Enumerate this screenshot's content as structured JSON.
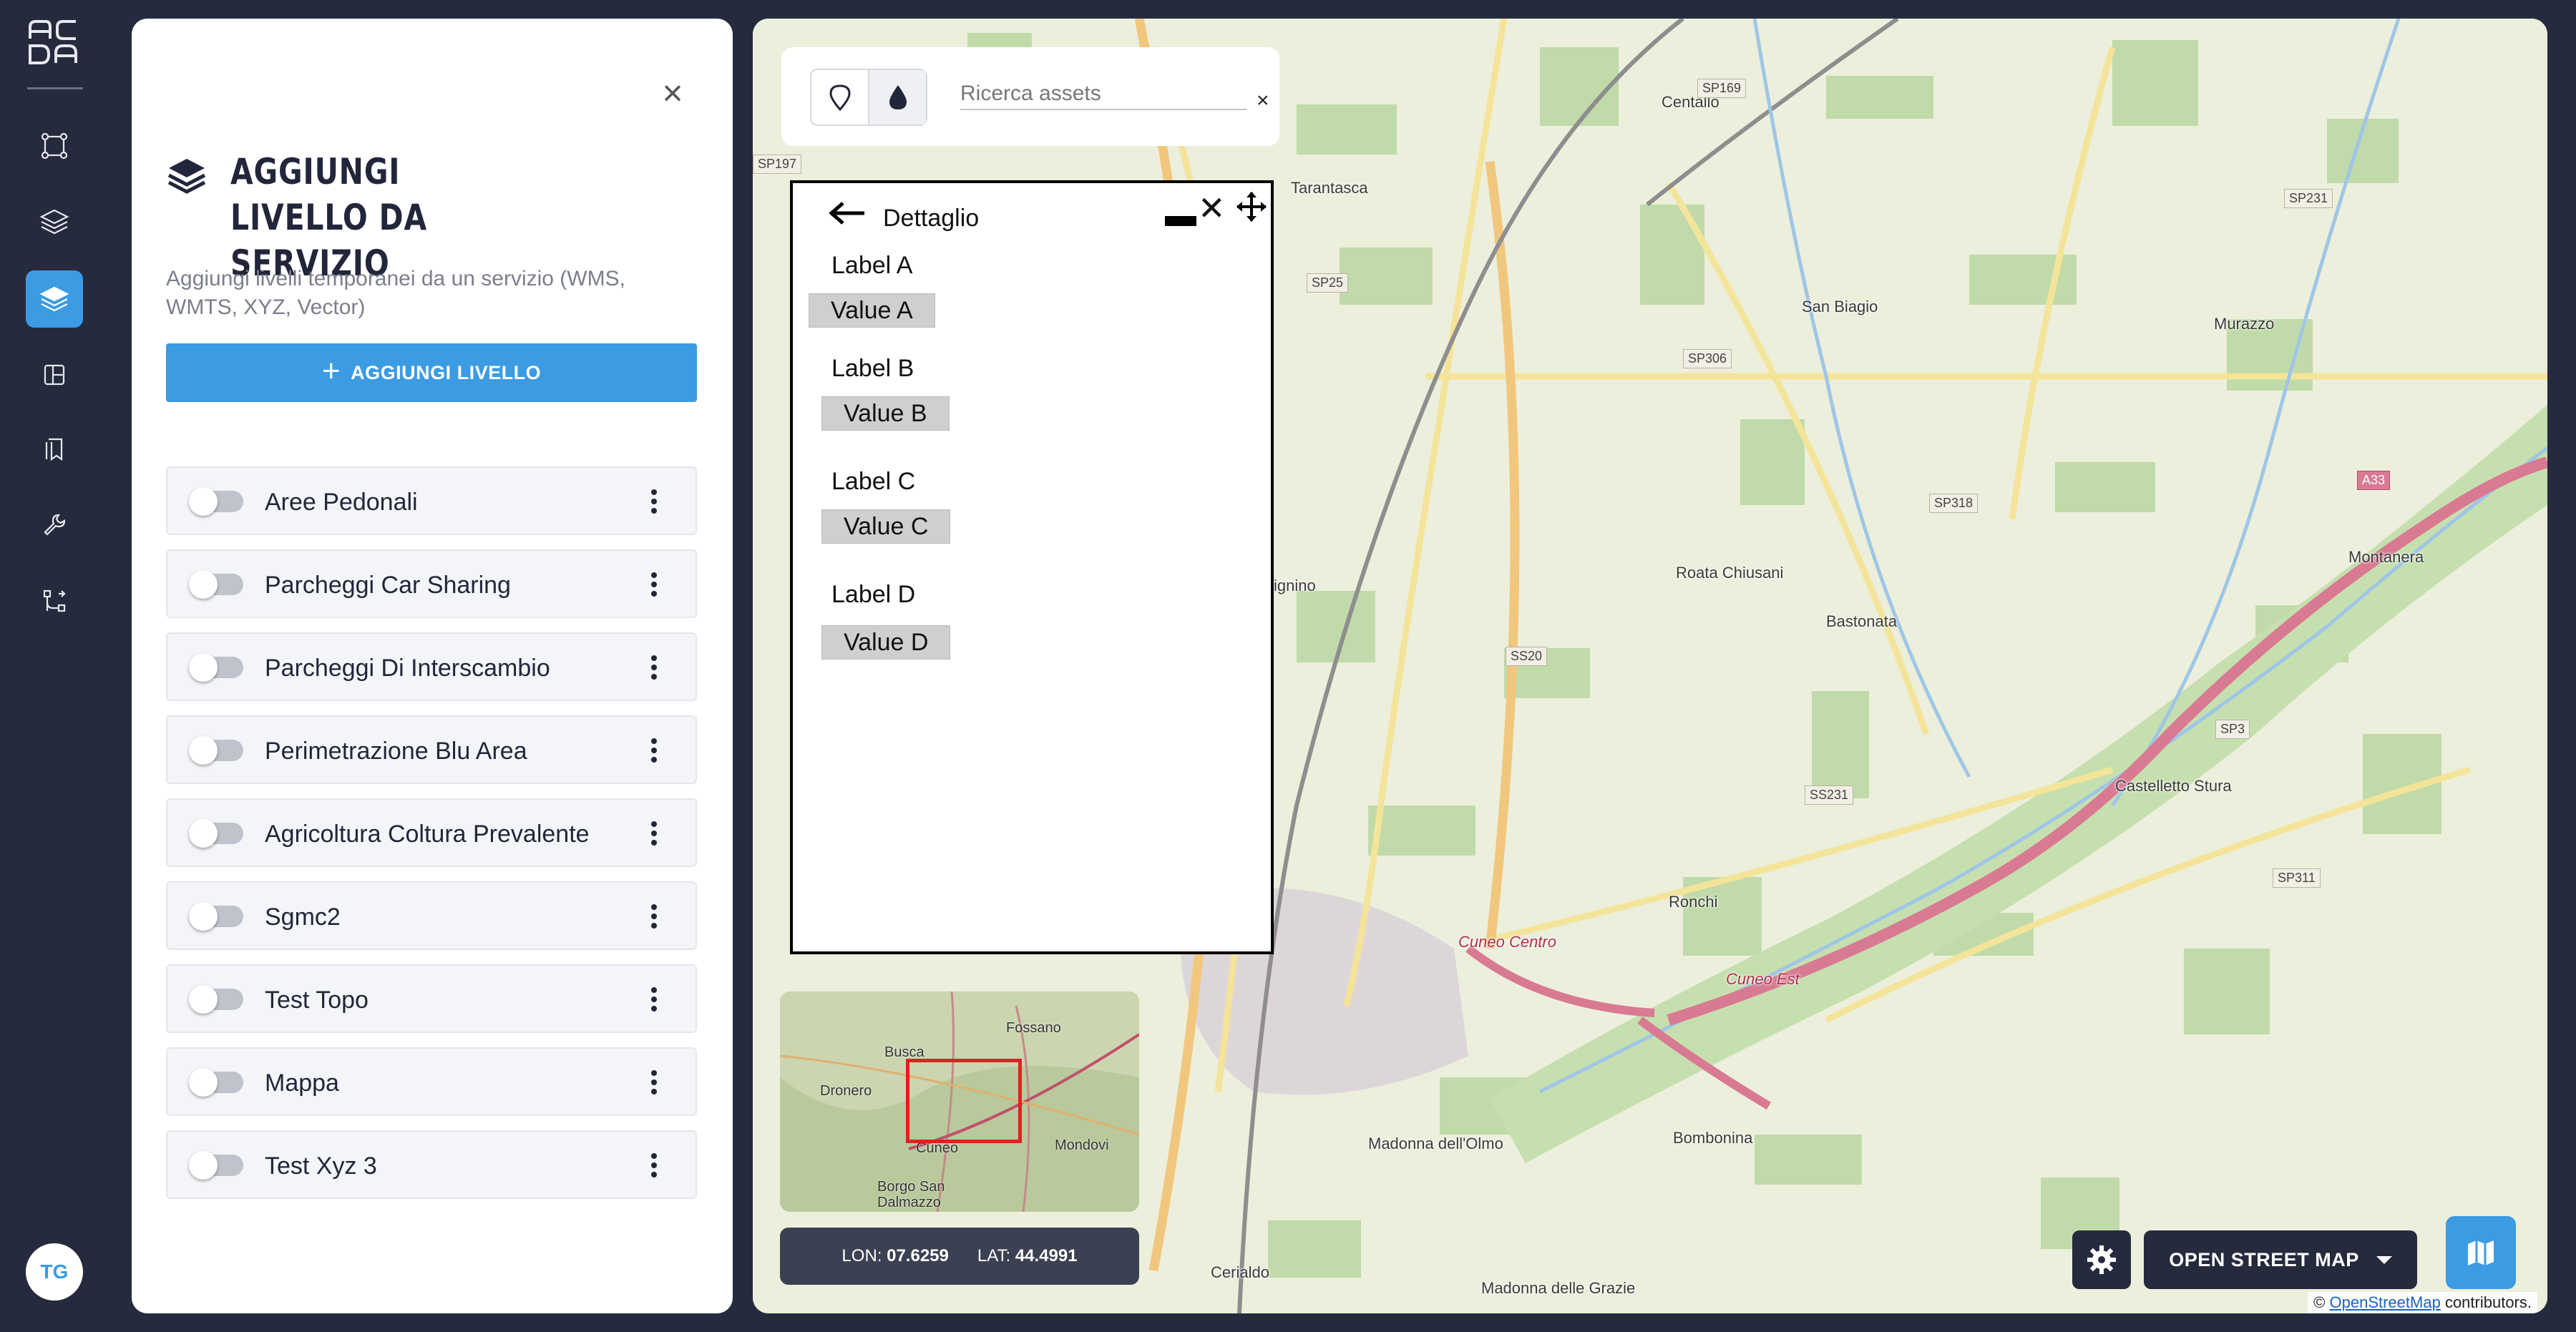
{
  "rail": {
    "logo": "ACDA",
    "items": [
      {
        "icon": "selection-square-icon",
        "active": false
      },
      {
        "icon": "layers-icon",
        "active": false
      },
      {
        "icon": "layers-filled-icon",
        "active": true
      },
      {
        "icon": "layout-icon",
        "active": false
      },
      {
        "icon": "bookmarks-icon",
        "active": false
      },
      {
        "icon": "wrench-icon",
        "active": false
      },
      {
        "icon": "workflow-icon",
        "active": false
      }
    ],
    "avatar_initials": "TG"
  },
  "panel": {
    "title": "AGGIUNGI LIVELLO DA SERVIZIO",
    "description": "Aggiungi livelli temporanei da un servizio (WMS, WMTS, XYZ, Vector)",
    "add_button": "AGGIUNGI LIVELLO",
    "layers": [
      {
        "name": "Aree Pedonali",
        "enabled": false
      },
      {
        "name": "Parcheggi Car Sharing",
        "enabled": false
      },
      {
        "name": "Parcheggi Di Interscambio",
        "enabled": false
      },
      {
        "name": "Perimetrazione Blu Area",
        "enabled": false
      },
      {
        "name": "Agricoltura Coltura Prevalente",
        "enabled": false
      },
      {
        "name": "Sgmc2",
        "enabled": false
      },
      {
        "name": "Test Topo",
        "enabled": false
      },
      {
        "name": "Mappa",
        "enabled": false
      },
      {
        "name": "Test Xyz 3",
        "enabled": false
      }
    ]
  },
  "search": {
    "placeholder": "Ricerca assets",
    "clear": "×"
  },
  "detail": {
    "title": "Dettaglio",
    "fields": [
      {
        "label": "Label A",
        "value": "Value A"
      },
      {
        "label": "Label B",
        "value": "Value B"
      },
      {
        "label": "Label C",
        "value": "Value C"
      },
      {
        "label": "Label D",
        "value": "Value D"
      }
    ]
  },
  "map": {
    "places": [
      "Centallo",
      "Tarantasca",
      "San Biagio",
      "Murazzo",
      "Roata Chiusani",
      "Bastonata",
      "Montanera",
      "Castelletto Stura",
      "Ronchi",
      "Cuneo Centro",
      "Cuneo Est",
      "Madonna dell'Olmo",
      "Bombonina",
      "Cerialdo",
      "Madonna delle Grazie",
      "ignino"
    ],
    "road_shields": [
      "SP169",
      "SP231",
      "SP25",
      "SP306",
      "SP318",
      "SS20",
      "SS231",
      "SP3",
      "SP311",
      "A33",
      "SP197"
    ],
    "minimap_places": [
      "Busca",
      "Fossano",
      "Dronero",
      "Cuneo",
      "Mondovi",
      "Borgo San Dalmazzo"
    ]
  },
  "coords": {
    "lon_label": "LON:",
    "lon": "07.6259",
    "lat_label": "LAT:",
    "lat": "44.4991"
  },
  "basemap": {
    "label": "OPEN STREET MAP"
  },
  "attribution": {
    "prefix": "©",
    "link": "OpenStreetMap",
    "suffix": "contributors."
  },
  "colors": {
    "accent": "#3b9be3",
    "rail": "#262a3d",
    "motorway": "#d97a93"
  }
}
